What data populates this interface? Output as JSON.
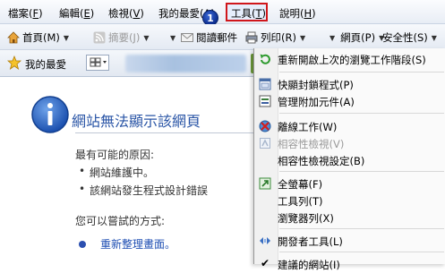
{
  "menubar": {
    "items": [
      {
        "text": "檔案",
        "key": "F"
      },
      {
        "text": "編輯",
        "key": "E"
      },
      {
        "text": "檢視",
        "key": "V"
      },
      {
        "text": "我的最愛",
        "key": "A"
      },
      {
        "text": "工具",
        "key": "T"
      },
      {
        "text": "說明",
        "key": "H"
      }
    ],
    "step_badge": "1"
  },
  "toolbar": {
    "home": "首頁(M)",
    "feeds": "摘要(J)",
    "read_mail": "閱讀郵件",
    "print": "列印(R)",
    "page": "網頁(P)",
    "safety": "安全性(S)"
  },
  "favbar": {
    "label": "我的最愛"
  },
  "page": {
    "title": "網站無法顯示該網頁",
    "causes_heading": "最有可能的原因:",
    "causes": [
      "網站維護中。",
      "該網站發生程式設計錯誤"
    ],
    "try_heading": "您可以嘗試的方式:",
    "try_link": "重新整理畫面。"
  },
  "tools_menu": {
    "items": [
      {
        "label": "重新開啟上次的瀏覽工作階段(S)",
        "icon": "reopen-session-icon",
        "enabled": true
      },
      {
        "label": "快顯封鎖程式(P)",
        "icon": "popup-blocker-icon",
        "enabled": true
      },
      {
        "label": "管理附加元件(A)",
        "icon": "addons-icon",
        "enabled": true
      },
      {
        "label": "離線工作(W)",
        "icon": "offline-icon",
        "enabled": true
      },
      {
        "label": "相容性檢視(V)",
        "icon": "compatibility-view-icon",
        "enabled": false
      },
      {
        "label": "相容性檢視設定(B)",
        "icon": "",
        "enabled": true
      },
      {
        "label": "全螢幕(F)",
        "icon": "fullscreen-icon",
        "enabled": true
      },
      {
        "label": "工具列(T)",
        "icon": "",
        "enabled": true
      },
      {
        "label": "瀏覽器列(X)",
        "icon": "",
        "enabled": true
      },
      {
        "label": "開發者工具(L)",
        "icon": "developer-tools-icon",
        "enabled": true
      },
      {
        "label": "建議的網站(I)",
        "icon": "checkmark-icon",
        "enabled": true
      }
    ]
  },
  "colors": {
    "highlight_border": "#d0161b",
    "link": "#1f4fb3",
    "title": "#2a55a6"
  }
}
